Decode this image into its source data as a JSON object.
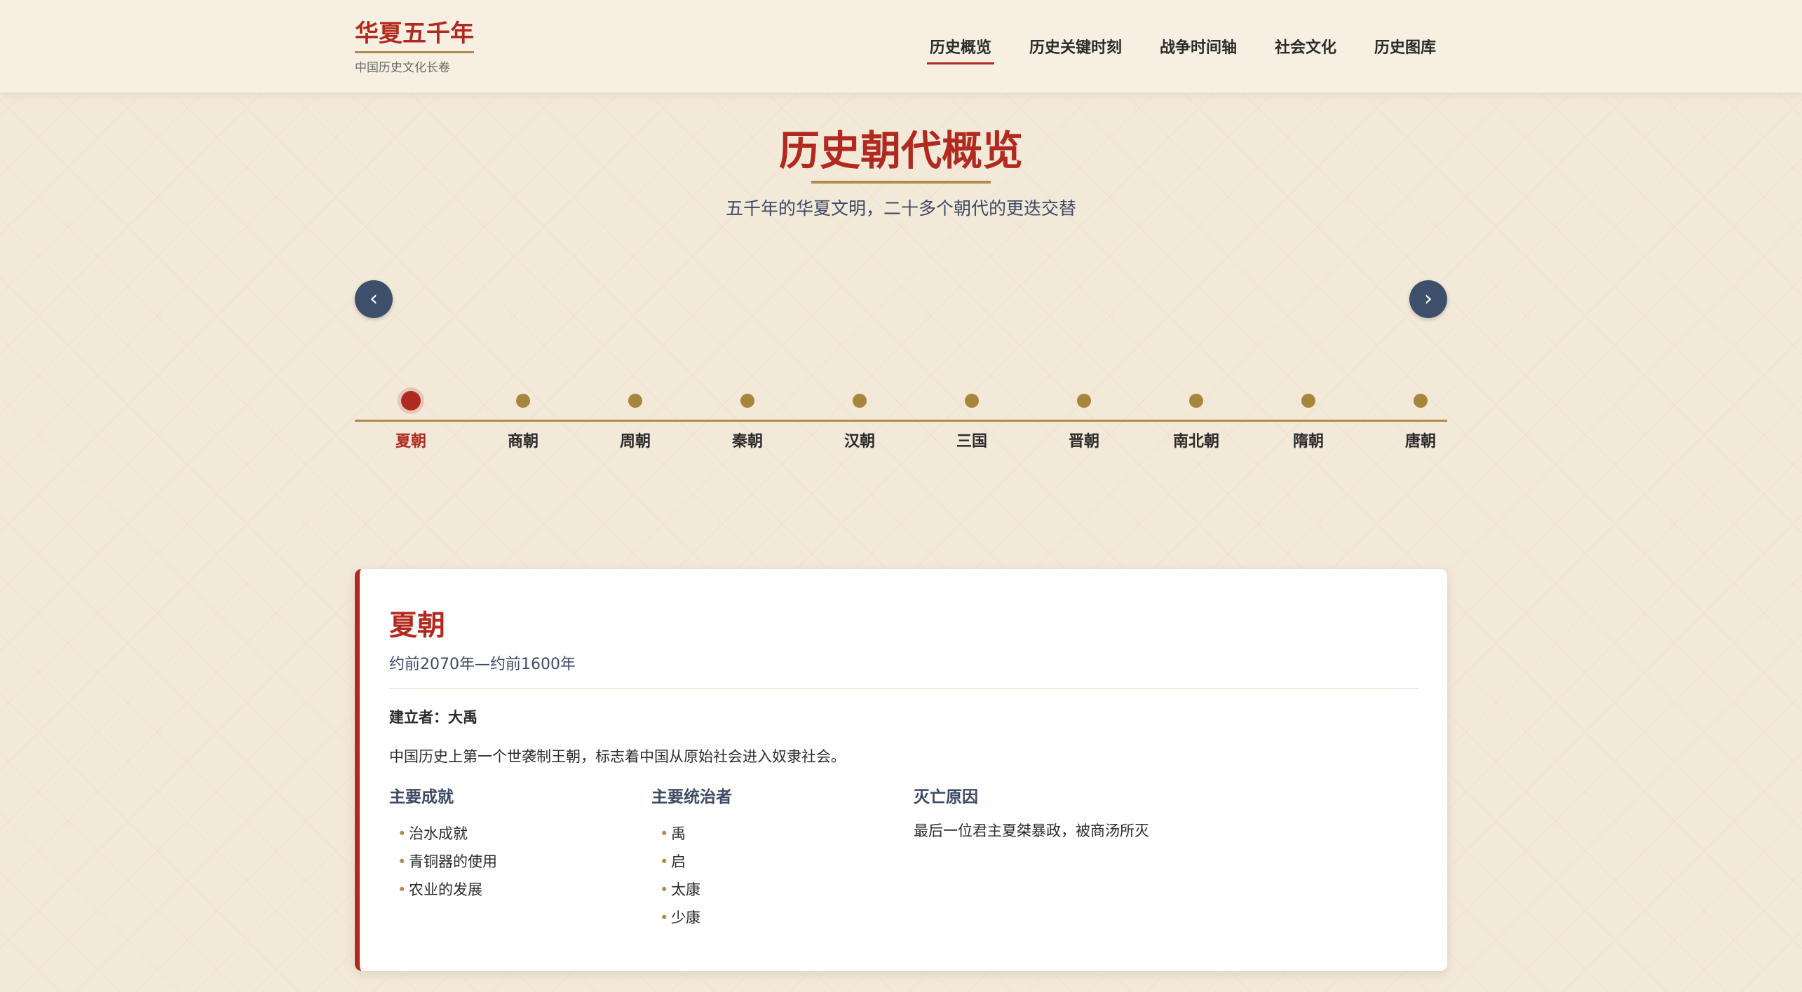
{
  "header": {
    "logo_title": "华夏五千年",
    "logo_subtitle": "中国历史文化长卷",
    "nav": [
      {
        "label": "历史概览",
        "active": true
      },
      {
        "label": "历史关键时刻",
        "active": false
      },
      {
        "label": "战争时间轴",
        "active": false
      },
      {
        "label": "社会文化",
        "active": false
      },
      {
        "label": "历史图库",
        "active": false
      }
    ]
  },
  "section": {
    "title": "历史朝代概览",
    "subtitle": "五千年的华夏文明，二十多个朝代的更迭交替"
  },
  "arrows": {
    "prev": "‹",
    "next": "›"
  },
  "timeline": {
    "items": [
      "夏朝",
      "商朝",
      "周朝",
      "秦朝",
      "汉朝",
      "三国",
      "晋朝",
      "南北朝",
      "隋朝",
      "唐朝"
    ],
    "active_index": 0
  },
  "card": {
    "title": "夏朝",
    "period": "约前2070年—约前1600年",
    "founder": "建立者：大禹",
    "description": "中国历史上第一个世袭制王朝，标志着中国从原始社会进入奴隶社会。",
    "achievements_title": "主要成就",
    "achievements": [
      "治水成就",
      "青铜器的使用",
      "农业的发展"
    ],
    "rulers_title": "主要统治者",
    "rulers": [
      "禹",
      "启",
      "太康",
      "少康"
    ],
    "fall_title": "灭亡原因",
    "fall_text": "最后一位君主夏桀暴政，被商汤所灭"
  },
  "colors": {
    "accent": "#b22a1f",
    "gold": "#b08b4a",
    "navy": "#3e4f6c",
    "background": "#f3e9d9"
  }
}
